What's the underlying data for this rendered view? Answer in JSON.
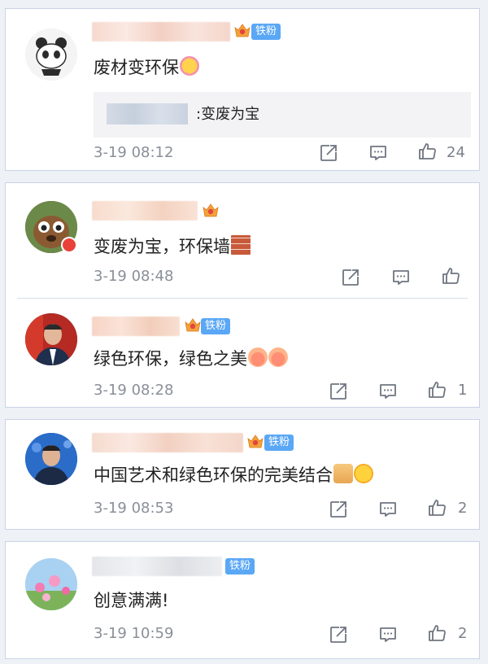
{
  "comments": [
    {
      "badge_level": "5",
      "fan_tag": "铁粉",
      "text": "废材变环保",
      "reply": {
        "text": ":变废为宝"
      },
      "time": "3-19 08:12",
      "likes": "24"
    },
    {
      "badge_level": "6",
      "fan_tag": "",
      "text": "变废为宝，环保墙",
      "time": "3-19 08:48",
      "likes": ""
    },
    {
      "badge_level": "",
      "fan_tag": "铁粉",
      "text": "绿色环保，绿色之美",
      "time": "3-19 08:28",
      "likes": "1"
    },
    {
      "badge_level": "5",
      "fan_tag": "铁粉",
      "text": "中国艺术和绿色环保的完美结合",
      "time": "3-19 08:53",
      "likes": "2"
    },
    {
      "badge_level": "",
      "fan_tag": "铁粉",
      "text": "创意满满!",
      "time": "3-19 10:59",
      "likes": "2"
    }
  ],
  "icons": {
    "share": "share-icon",
    "comment": "comment-icon",
    "like": "thumbs-up-icon"
  },
  "colors": {
    "fan_tag": "#5aa7f5",
    "time": "#8a8f99",
    "card_border": "#c9d3e6"
  }
}
